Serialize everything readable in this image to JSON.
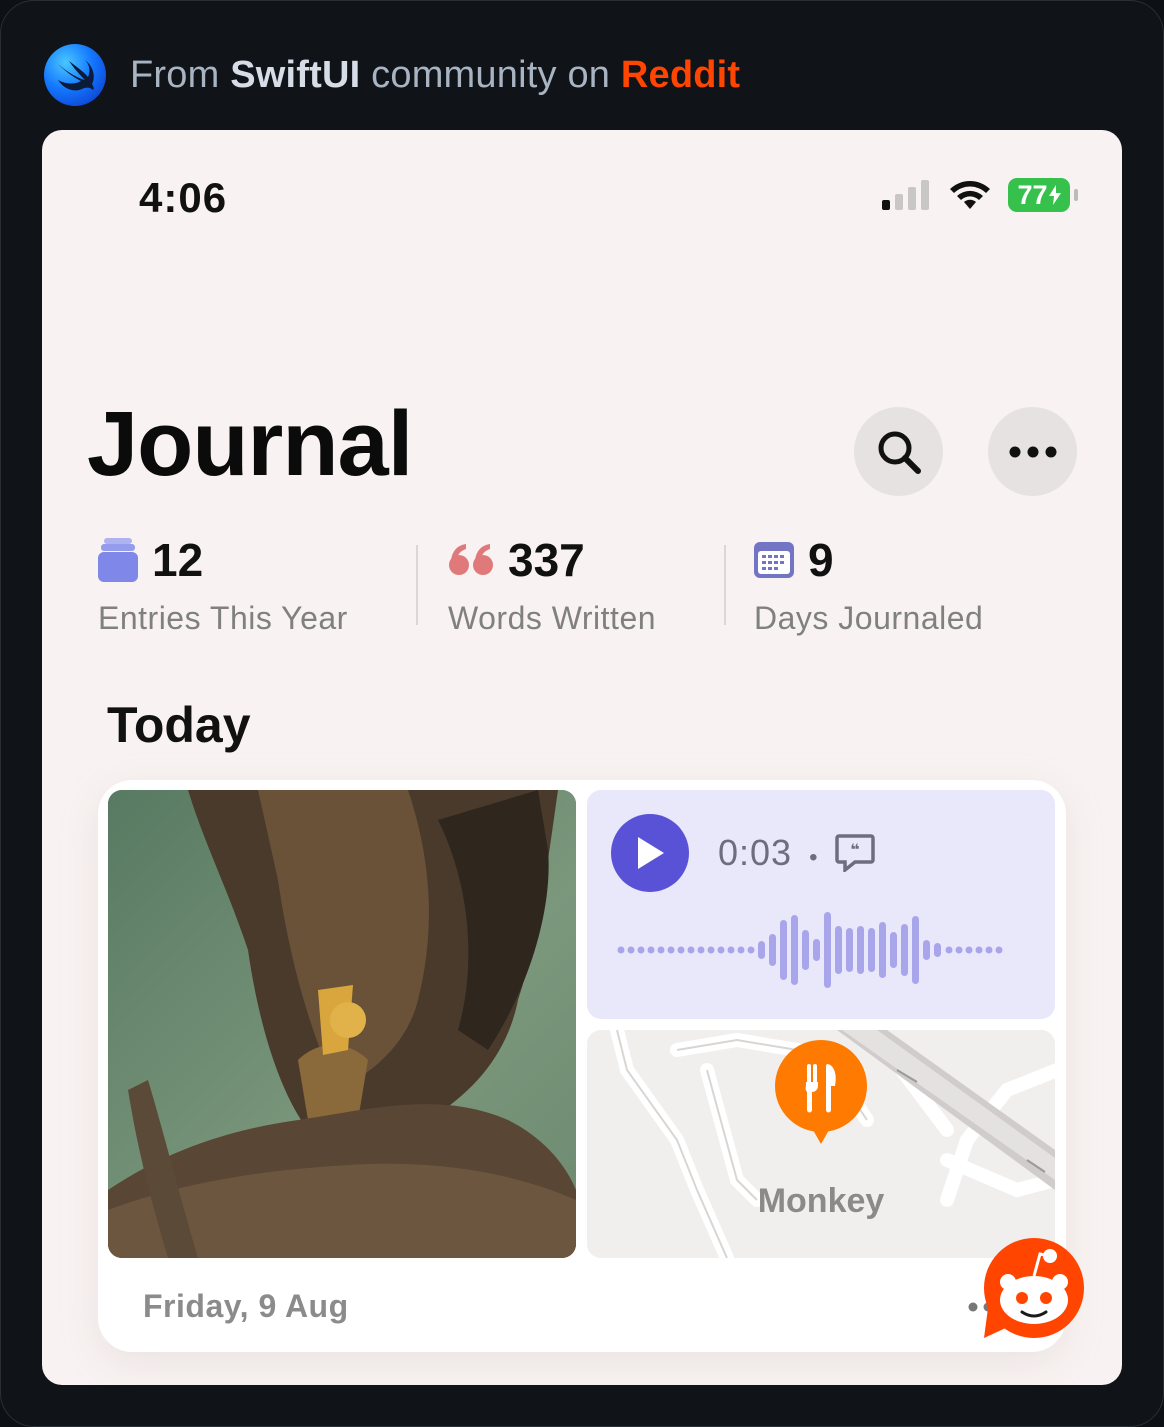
{
  "banner": {
    "prefix": "From",
    "community": "SwiftUI",
    "middle": "community on",
    "site": "Reddit"
  },
  "status_bar": {
    "time": "4:06",
    "battery": "77"
  },
  "header": {
    "title": "Journal",
    "search_icon": "magnifying-glass-icon",
    "more_icon": "ellipsis-icon"
  },
  "stats": [
    {
      "value": "12",
      "label": "Entries This Year",
      "icon": "stack-icon"
    },
    {
      "value": "337",
      "label": "Words Written",
      "icon": "quote-icon"
    },
    {
      "value": "9",
      "label": "Days Journaled",
      "icon": "calendar-icon"
    }
  ],
  "today": {
    "heading": "Today",
    "entry": {
      "audio_duration": "0:03",
      "audio_separator": "•",
      "place": "Monkey",
      "date": "Friday, 9 Aug"
    }
  },
  "colors": {
    "accent_purple": "#5a52d6",
    "waveform": "#a9a5ea",
    "pin_orange": "#ff7a00",
    "battery_green": "#36c14c",
    "reddit_orange": "#ff4500"
  }
}
